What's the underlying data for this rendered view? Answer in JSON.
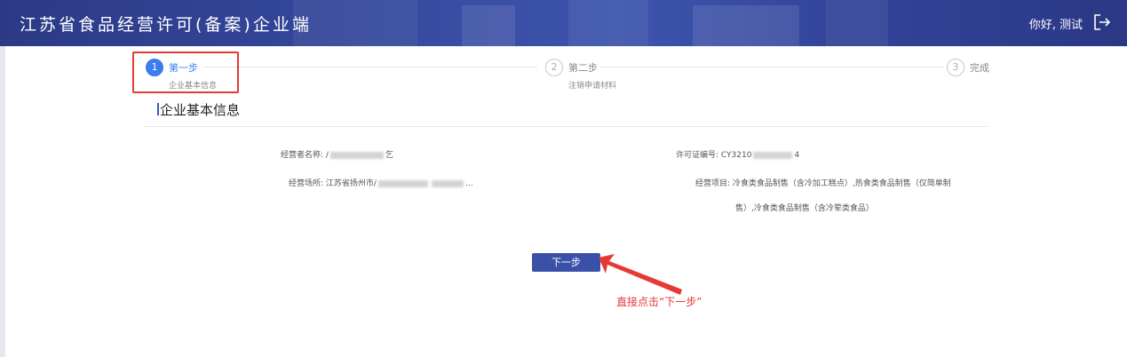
{
  "header": {
    "app_title": "江苏省食品经营许可(备案)企业端",
    "greeting": "你好, 测试"
  },
  "steps": [
    {
      "number": "1",
      "label": "第一步",
      "sub": "企业基本信息",
      "active": true
    },
    {
      "number": "2",
      "label": "第二步",
      "sub": "注销申请材料",
      "active": false
    },
    {
      "number": "3",
      "label": "完成",
      "sub": "",
      "active": false
    }
  ],
  "section": {
    "title": "企业基本信息"
  },
  "fields": {
    "operator_name_label": "经营者名称:",
    "operator_name_value_start": "/",
    "operator_name_value_end": "乞",
    "license_no_label": "许可证编号:",
    "license_no_value_start": "CY3210",
    "license_no_value_end": "4",
    "premises_label": "经营场所:",
    "premises_value_start": "江苏省扬州市/",
    "premises_value_mid": "...",
    "business_items_label": "经营项目:",
    "business_items_line1": "冷食类食品制售（含冷加工糕点）,热食类食品制售（仅简单制",
    "business_items_line2": "售）,冷食类食品制售（含冷荤类食品）"
  },
  "actions": {
    "next_label": "下一步"
  },
  "annotation": {
    "text": "直接点击“下一步”"
  },
  "colors": {
    "header_bg": "#34479b",
    "accent": "#3b7cf0",
    "button": "#3a51a8",
    "annotation_red": "#e53935"
  }
}
